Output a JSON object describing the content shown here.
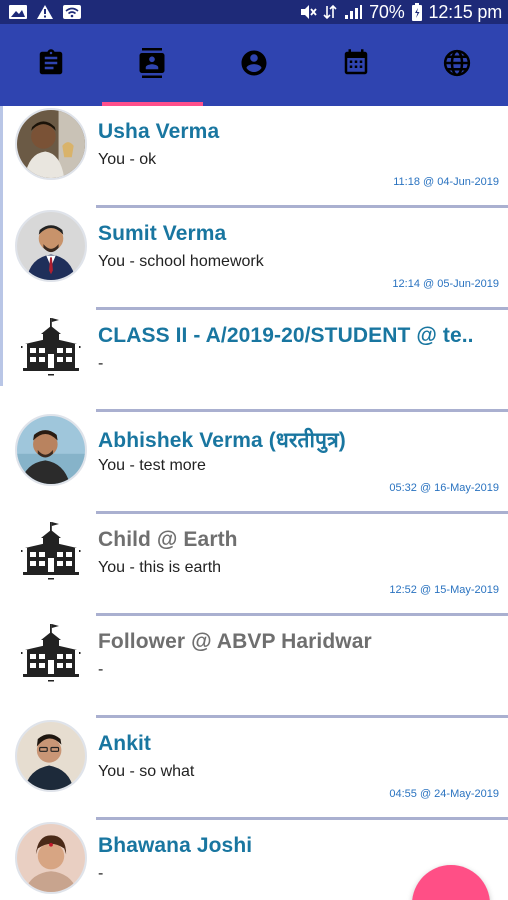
{
  "status_bar": {
    "battery": "70%",
    "time": "12:15 pm",
    "left_icons": [
      "gallery-icon",
      "warning-icon",
      "wifi-icon"
    ],
    "right_icons": [
      "mute-icon",
      "data-icon",
      "signal-icon",
      "battery-icon"
    ]
  },
  "tabs": [
    {
      "icon": "clipboard-icon",
      "active": false
    },
    {
      "icon": "contacts-icon",
      "active": true
    },
    {
      "icon": "account-icon",
      "active": false
    },
    {
      "icon": "calendar-icon",
      "active": false
    },
    {
      "icon": "globe-icon",
      "active": false
    }
  ],
  "chats": [
    {
      "name": "Usha Verma",
      "message": "You - ok",
      "time": "11:18 @ 04-Jun-2019",
      "avatar": "photo"
    },
    {
      "name": "Sumit Verma",
      "message": "You - school homework",
      "time": "12:14 @ 05-Jun-2019",
      "avatar": "photo"
    },
    {
      "name": "CLASS II - A/2019-20/STUDENT @ te..",
      "message": "-",
      "time": "",
      "avatar": "school-icon"
    },
    {
      "name": "Abhishek Verma (धरतीपुत्र)",
      "message": "You - test more",
      "time": "05:32 @ 16-May-2019",
      "avatar": "photo"
    },
    {
      "name": "Child @ Earth",
      "message": "You - this is earth",
      "time": "12:52 @ 15-May-2019",
      "avatar": "school-icon"
    },
    {
      "name": "Follower @ ABVP Haridwar",
      "message": "-",
      "time": "",
      "avatar": "school-icon"
    },
    {
      "name": "Ankit",
      "message": "You - so what",
      "time": "04:55 @ 24-May-2019",
      "avatar": "photo"
    },
    {
      "name": "Bhawana Joshi",
      "message": "-",
      "time": "",
      "avatar": "photo"
    }
  ],
  "colors": {
    "status_bar": "#1e2a78",
    "tab_bar": "#2f44b0",
    "tab_indicator": "#ff4f8b",
    "name_blue": "#1976a0",
    "name_gray": "#6f6f6f",
    "timestamp": "#2a73c0",
    "fab": "#ff4f86"
  }
}
